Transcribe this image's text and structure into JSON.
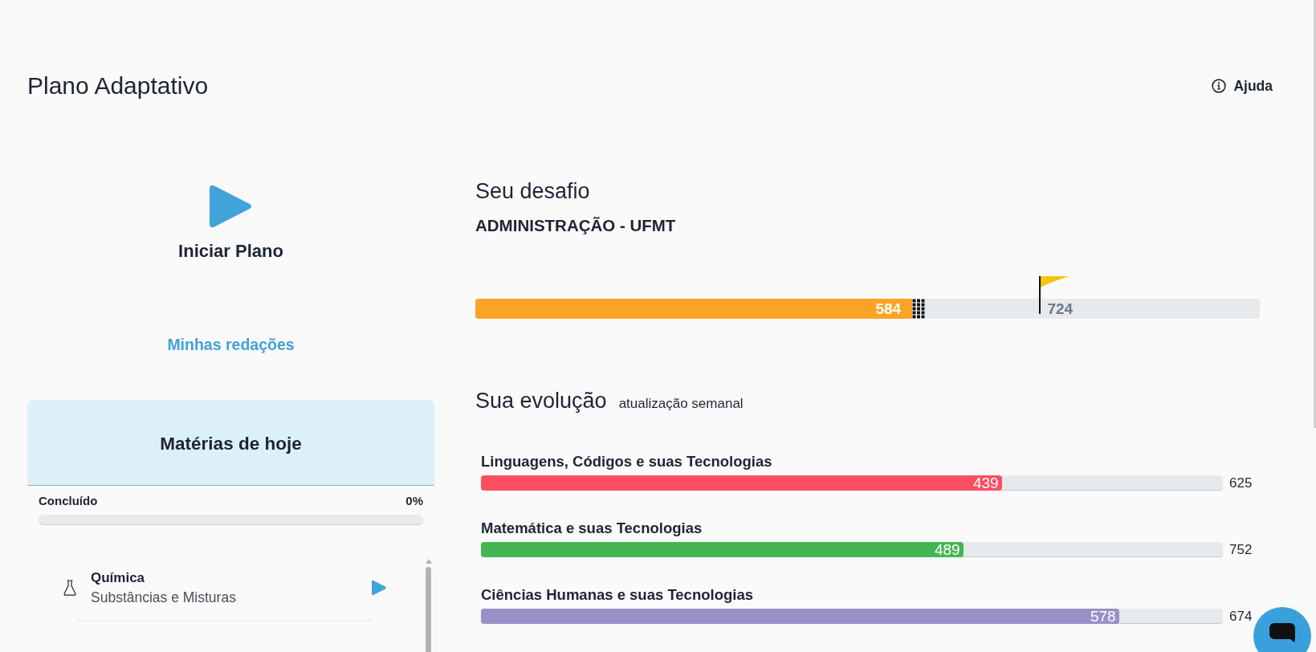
{
  "header": {
    "title": "Plano Adaptativo",
    "help_link": "Ajuda"
  },
  "start_plan": {
    "label": "Iniciar Plano"
  },
  "essays_link": "Minhas redações",
  "todays_subjects": {
    "title": "Matérias de hoje",
    "progress_label": "Concluído",
    "progress_value": "0%",
    "level": 0,
    "items": [
      {
        "subject": "Química",
        "topic": "Substâncias e Misturas"
      }
    ]
  },
  "challenge": {
    "heading": "Seu desafio",
    "course": "ADMINISTRAÇÃO - UFMT",
    "score": "584",
    "level": 0.557,
    "goal": {
      "label": "724",
      "level": 0.72
    }
  },
  "evolution": {
    "heading": "Sua evolução",
    "note": "atualização semanal",
    "areas": [
      {
        "name": "Linguagens, Códigos e suas Tecnologias",
        "score": "439",
        "total": "625",
        "level": 0.702,
        "color": "#fc4f62"
      },
      {
        "name": "Matemática e suas Tecnologias",
        "score": "489",
        "total": "752",
        "level": 0.65,
        "color": "#45b553"
      },
      {
        "name": "Ciências Humanas e suas Tecnologias",
        "score": "578",
        "total": "674",
        "level": 0.86,
        "color": "#9a8fc9"
      }
    ]
  }
}
